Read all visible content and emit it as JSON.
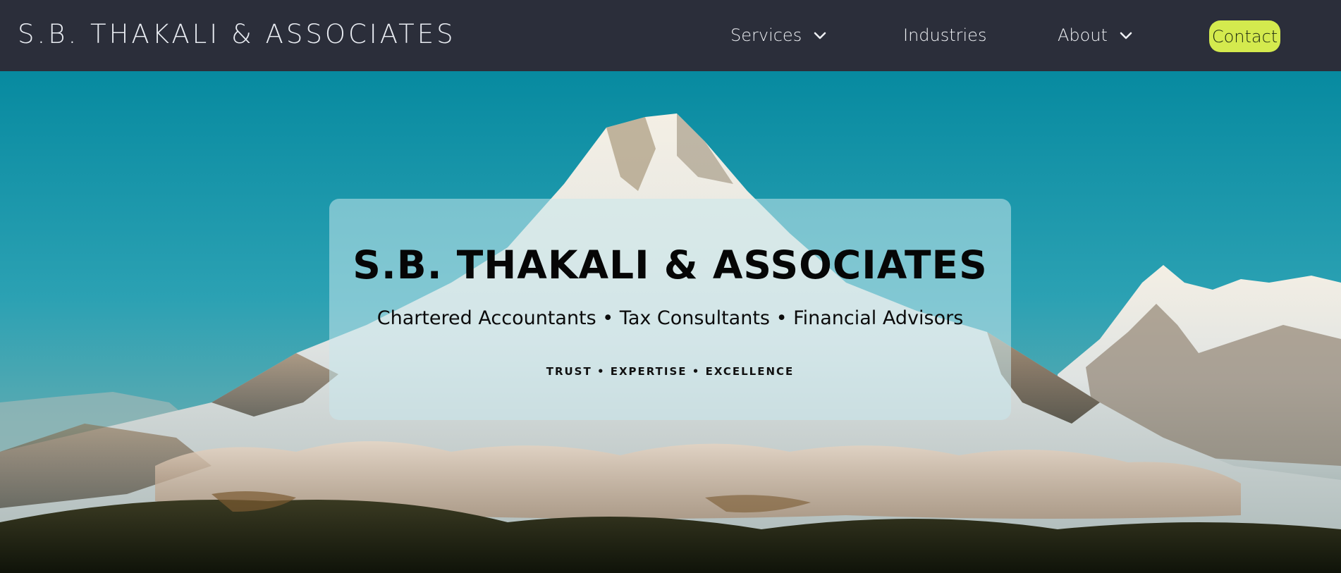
{
  "header": {
    "brand": "S.B. THAKALI & ASSOCIATES",
    "nav": {
      "services": "Services",
      "industries": "Industries",
      "about": "About",
      "contact": "Contact"
    },
    "colors": {
      "navbar_bg": "#2b2e3a",
      "contact_accent": "#d4ea4e"
    }
  },
  "hero": {
    "title": "S.B. THAKALI & ASSOCIATES",
    "subtitle": "Chartered Accountants • Tax Consultants • Financial Advisors",
    "tagline": "TRUST • EXPERTISE • EXCELLENCE"
  },
  "icons": {
    "services_dropdown": "chevron-down-icon",
    "about_dropdown": "chevron-down-icon"
  }
}
